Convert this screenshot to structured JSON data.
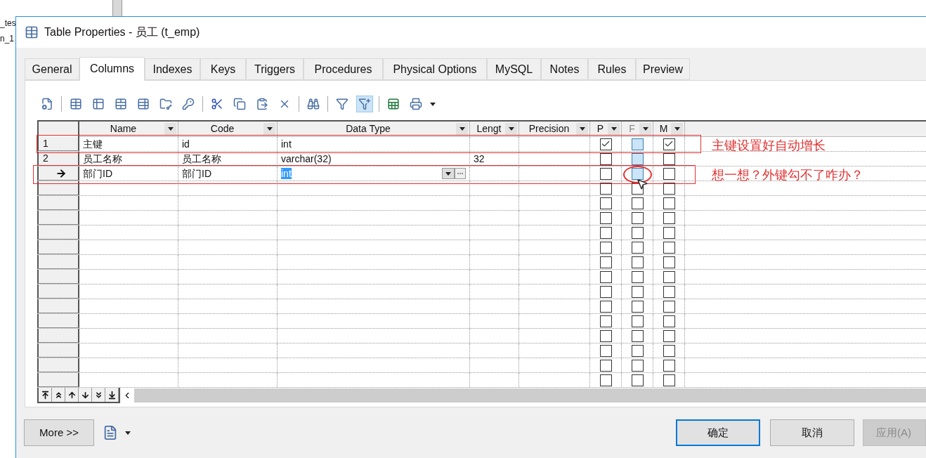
{
  "background_texts": [
    "_tes",
    "n_1"
  ],
  "window": {
    "title": "Table Properties - 员工 (t_emp)"
  },
  "tabs": [
    {
      "label": "General",
      "selected": false
    },
    {
      "label": "Columns",
      "selected": true
    },
    {
      "label": "Indexes",
      "selected": false
    },
    {
      "label": "Keys",
      "selected": false
    },
    {
      "label": "Triggers",
      "selected": false
    },
    {
      "label": "Procedures",
      "selected": false
    },
    {
      "label": "Physical Options",
      "selected": false
    },
    {
      "label": "MySQL",
      "selected": false
    },
    {
      "label": "Notes",
      "selected": false
    },
    {
      "label": "Rules",
      "selected": false
    },
    {
      "label": "Preview",
      "selected": false
    }
  ],
  "grid": {
    "columns": [
      {
        "label": "Name",
        "disabled": false
      },
      {
        "label": "Code",
        "disabled": false
      },
      {
        "label": "Data Type",
        "disabled": false
      },
      {
        "label": "Lengt",
        "disabled": false
      },
      {
        "label": "Precision",
        "disabled": false
      },
      {
        "label": "P",
        "disabled": false
      },
      {
        "label": "F",
        "disabled": true
      },
      {
        "label": "M",
        "disabled": false
      }
    ],
    "rows": [
      {
        "number": "1",
        "current": false,
        "name": "主键",
        "code": "id",
        "data_type": "int",
        "primary": true,
        "foreign": false,
        "mandatory": true,
        "foreign_highlighted": true
      },
      {
        "number": "2",
        "current": false,
        "name": "员工名称",
        "code": "员工名称",
        "data_type": "varchar(32)",
        "length": "32",
        "primary": false,
        "foreign": false,
        "mandatory": false,
        "foreign_highlighted": true
      },
      {
        "current": true,
        "name": "部门ID",
        "code": "部门ID",
        "data_type": "int",
        "primary": false,
        "foreign": false,
        "mandatory": false,
        "foreign_highlighted": true
      },
      {
        "current": false,
        "primary": false,
        "foreign": false,
        "mandatory": false,
        "foreign_highlighted": false
      },
      {
        "current": false,
        "primary": false,
        "foreign": false,
        "mandatory": false,
        "foreign_highlighted": false
      },
      {
        "current": false,
        "primary": false,
        "foreign": false,
        "mandatory": false,
        "foreign_highlighted": false
      },
      {
        "current": false,
        "primary": false,
        "foreign": false,
        "mandatory": false,
        "foreign_highlighted": false
      },
      {
        "current": false,
        "primary": false,
        "foreign": false,
        "mandatory": false,
        "foreign_highlighted": false
      },
      {
        "current": false,
        "primary": false,
        "foreign": false,
        "mandatory": false,
        "foreign_highlighted": false
      },
      {
        "current": false,
        "primary": false,
        "foreign": false,
        "mandatory": false,
        "foreign_highlighted": false
      },
      {
        "current": false,
        "primary": false,
        "foreign": false,
        "mandatory": false,
        "foreign_highlighted": false
      },
      {
        "current": false,
        "primary": false,
        "foreign": false,
        "mandatory": false,
        "foreign_highlighted": false
      },
      {
        "current": false,
        "primary": false,
        "foreign": false,
        "mandatory": false,
        "foreign_highlighted": false
      },
      {
        "current": false,
        "primary": false,
        "foreign": false,
        "mandatory": false,
        "foreign_highlighted": false
      },
      {
        "current": false,
        "primary": false,
        "foreign": false,
        "mandatory": false,
        "foreign_highlighted": false
      },
      {
        "current": false,
        "primary": false,
        "foreign": false,
        "mandatory": false,
        "foreign_highlighted": false
      },
      {
        "current": false,
        "primary": false,
        "foreign": false,
        "mandatory": false,
        "foreign_highlighted": false
      }
    ]
  },
  "annotations": [
    {
      "text": "主键设置好自动增长"
    },
    {
      "text": "想一想？外键勾不了咋办？"
    }
  ],
  "buttons": {
    "more": {
      "label": "More >>"
    },
    "ok": {
      "label": "确定",
      "default": true
    },
    "cancel": {
      "label": "取消"
    },
    "apply": {
      "label": "应用(A)",
      "disabled": true
    }
  }
}
